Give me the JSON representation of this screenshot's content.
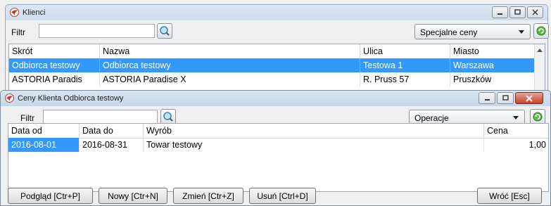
{
  "klienci": {
    "title": "Klienci",
    "filter_label": "Filtr",
    "filter_value": "",
    "select_value": "Specjalne ceny",
    "columns": [
      "Skrót",
      "Nazwa",
      "Ulica",
      "Miasto"
    ],
    "rows": [
      [
        "Odbiorca testowy",
        "Odbiorca testowy",
        "Testowa 1",
        "Warszawa"
      ],
      [
        "ASTORIA Paradis",
        "ASTORIA Paradise X",
        "R. Pruss 57",
        "Pruszków"
      ]
    ]
  },
  "ceny": {
    "title": "Ceny Klienta Odbiorca testowy",
    "filter_label": "Filtr",
    "filter_value": "",
    "select_value": "Operacje",
    "columns": [
      "Data od",
      "Data do",
      "Wyrób",
      "Cena"
    ],
    "rows": [
      [
        "2016-08-01",
        "2016-08-31",
        "Towar testowy",
        "1,00"
      ]
    ],
    "buttons": {
      "preview": "Podgląd [Ctr+P]",
      "new": "Nowy [Ctr+N]",
      "edit": "Zmień [Ctr+Z]",
      "delete": "Usuń [Ctrl+D]",
      "back": "Wróć [Esc]"
    }
  },
  "colors": {
    "selection": "#3399ff",
    "close_button": "#c7422b",
    "refresh_green": "#3c9a2e"
  },
  "icons": {
    "app": "swallow-logo-icon",
    "search": "magnifier-icon",
    "refresh": "green-refresh-icon"
  }
}
